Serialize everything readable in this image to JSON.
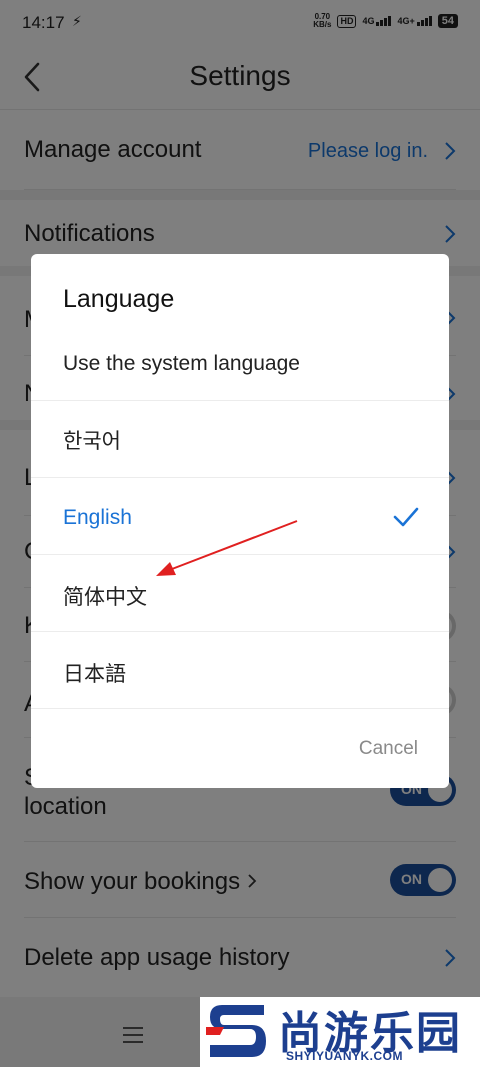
{
  "status_bar": {
    "time": "14:17",
    "net_speed_value": "0.70",
    "net_speed_unit": "KB/s",
    "hd": "HD",
    "sim1": "4G",
    "sim2": "4G+",
    "battery": "54"
  },
  "header": {
    "title": "Settings"
  },
  "settings": {
    "manage_account": {
      "label": "Manage account",
      "value": "Please log in."
    },
    "notifications": {
      "label": "Notifications"
    },
    "row3_letter": "M",
    "row4_letter": "N",
    "row5_letter": "L",
    "row6_letter": "C",
    "row7_letter": "K",
    "row8_letter": "A",
    "sharing": {
      "label_line1": "S",
      "label_line2": "location",
      "toggle": "ON"
    },
    "show_bookings": {
      "label": "Show your bookings",
      "toggle": "ON"
    },
    "delete_history": {
      "label": "Delete app usage history"
    }
  },
  "dialog": {
    "title": "Language",
    "options": [
      {
        "label": "Use the system language",
        "selected": false
      },
      {
        "label": "한국어",
        "selected": false
      },
      {
        "label": "English",
        "selected": true
      },
      {
        "label": "简体中文",
        "selected": false
      },
      {
        "label": "日本語",
        "selected": false
      }
    ],
    "cancel": "Cancel"
  },
  "watermark": {
    "text": "尚游乐园",
    "url": "SHYIYUANYK.COM"
  },
  "colors": {
    "accent": "#1a73d6",
    "toggle_on": "#1a4f9c",
    "arrow": "#e02020",
    "watermark": "#1d3f8f"
  }
}
